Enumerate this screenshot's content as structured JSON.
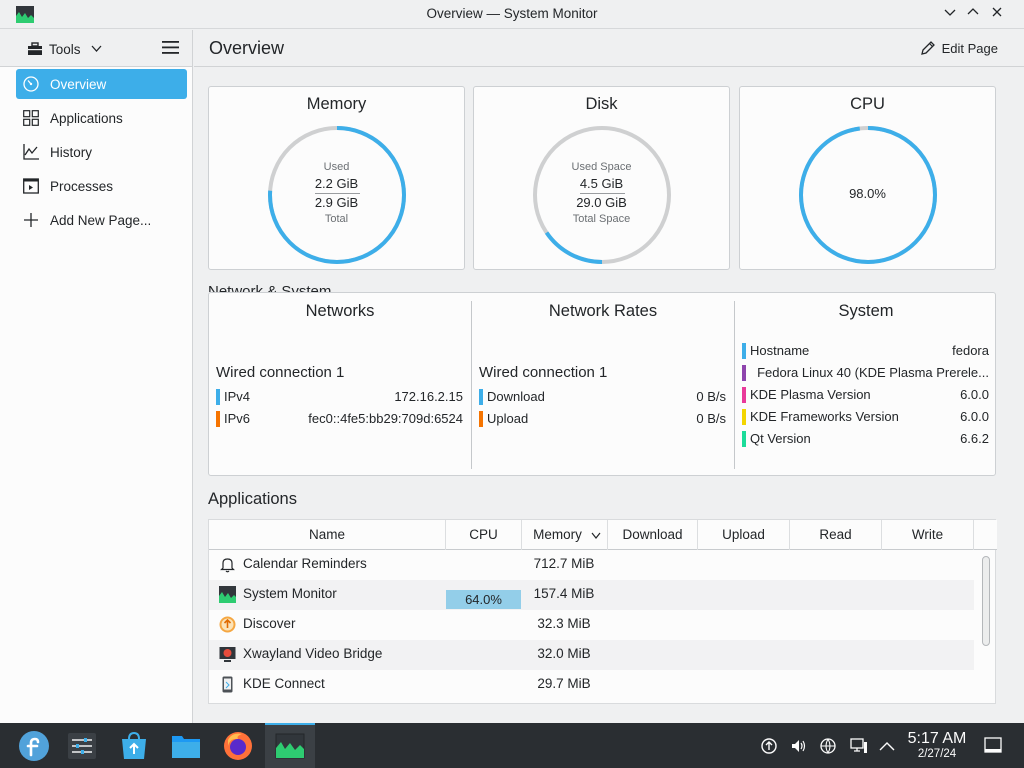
{
  "window": {
    "title": "Overview — System Monitor"
  },
  "sidebar": {
    "tools_label": "Tools",
    "items": [
      {
        "label": "Overview",
        "icon": "gauge-icon"
      },
      {
        "label": "Applications",
        "icon": "grid-icon"
      },
      {
        "label": "History",
        "icon": "chart-icon"
      },
      {
        "label": "Processes",
        "icon": "process-icon"
      },
      {
        "label": "Add New Page...",
        "icon": "plus-icon"
      }
    ]
  },
  "header": {
    "title": "Overview",
    "edit_label": "Edit Page"
  },
  "memory": {
    "title": "Memory",
    "top_label": "Used",
    "used": "2.2 GiB",
    "total": "2.9 GiB",
    "bottom_label": "Total",
    "fraction": 0.76
  },
  "disk": {
    "title": "Disk",
    "top_label": "Used Space",
    "used": "4.5 GiB",
    "total": "29.0 GiB",
    "bottom_label": "Total Space",
    "fraction": 0.155
  },
  "cpu": {
    "title": "CPU",
    "value": "98.0%",
    "fraction": 0.98
  },
  "network_section": {
    "title": "Network & System"
  },
  "networks": {
    "title": "Networks",
    "connection": "Wired connection 1",
    "rows": [
      {
        "label": "IPv4",
        "value": "172.16.2.15",
        "color": "#3daee9"
      },
      {
        "label": "IPv6",
        "value": "fec0::4fe5:bb29:709d:6524",
        "color": "#f67400"
      }
    ]
  },
  "rates": {
    "title": "Network Rates",
    "connection": "Wired connection 1",
    "rows": [
      {
        "label": "Download",
        "value": "0 B/s",
        "color": "#3daee9"
      },
      {
        "label": "Upload",
        "value": "0 B/s",
        "color": "#f67400"
      }
    ]
  },
  "system": {
    "title": "System",
    "rows": [
      {
        "label": "Hostname",
        "value": "fedora",
        "color": "#3daee9"
      },
      {
        "label": "",
        "value": "Fedora Linux 40 (KDE Plasma Prerele...",
        "color": "#8e44ad"
      },
      {
        "label": "KDE Plasma Version",
        "value": "6.0.0",
        "color": "#e93a9a"
      },
      {
        "label": "KDE Frameworks Version",
        "value": "6.0.0",
        "color": "#f3d500"
      },
      {
        "label": "Qt Version",
        "value": "6.6.2",
        "color": "#1cdc9a"
      }
    ]
  },
  "applications": {
    "title": "Applications",
    "columns": [
      "Name",
      "CPU",
      "Memory",
      "Download",
      "Upload",
      "Read",
      "Write"
    ],
    "rows": [
      {
        "name": "Calendar Reminders",
        "cpu": "",
        "memory": "712.7 MiB",
        "icon": "bell-icon"
      },
      {
        "name": "System Monitor",
        "cpu": "64.0%",
        "memory": "157.4 MiB",
        "icon": "system-monitor-icon"
      },
      {
        "name": "Discover",
        "cpu": "",
        "memory": "32.3 MiB",
        "icon": "discover-icon"
      },
      {
        "name": "Xwayland Video Bridge",
        "cpu": "",
        "memory": "32.0 MiB",
        "icon": "video-bridge-icon"
      },
      {
        "name": "KDE Connect",
        "cpu": "",
        "memory": "29.7 MiB",
        "icon": "phone-icon"
      }
    ]
  },
  "taskbar": {
    "time": "5:17 AM",
    "date": "2/27/24",
    "apps": [
      "fedora-launcher-icon",
      "system-settings-icon",
      "discover-icon",
      "file-manager-icon",
      "firefox-icon",
      "system-monitor-icon"
    ]
  },
  "colors": {
    "accent": "#3daee9",
    "track": "#cfd0d1",
    "panel": "#2a2e32"
  }
}
